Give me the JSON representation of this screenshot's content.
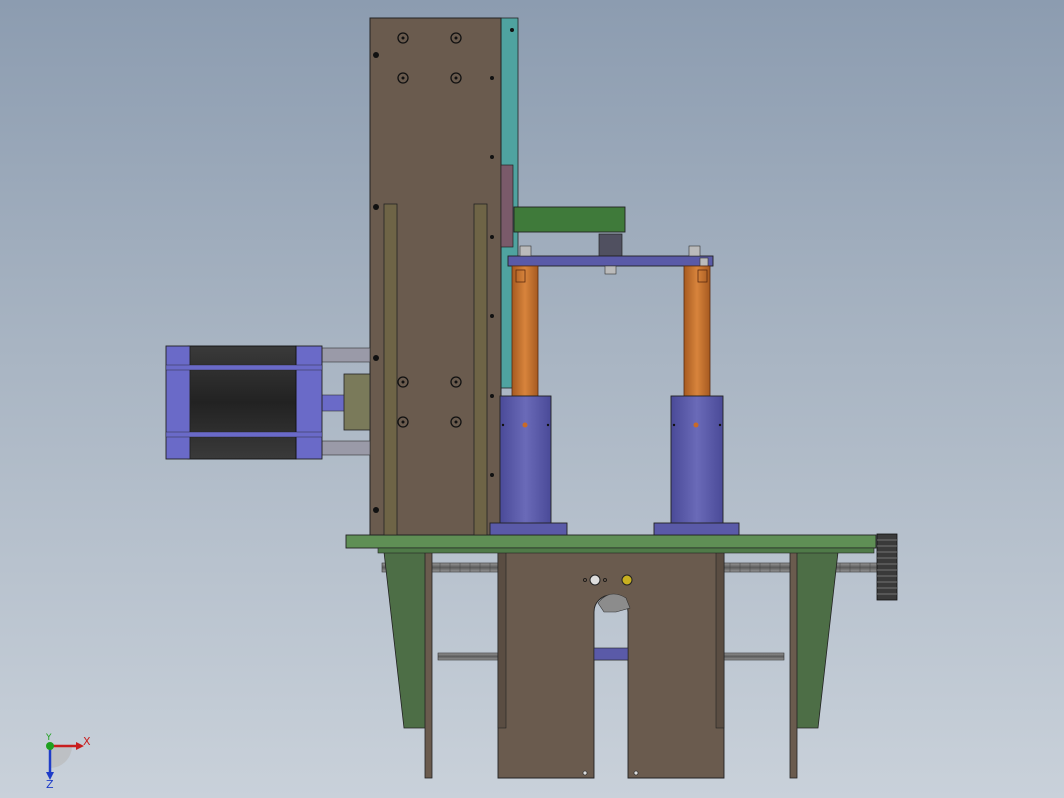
{
  "triad": {
    "x_label": "X",
    "y_label": "Y",
    "z_label": "Z",
    "x_color": "#c81e1e",
    "y_color": "#1ea01e",
    "z_color": "#1e3cc8"
  },
  "colors": {
    "background_top": "#8c9cb0",
    "background_bottom": "#c9d1da",
    "column_plate": "#6a5b4e",
    "frame_plate": "#6a5b4e",
    "guide_rail": "#6e6446",
    "side_rail": "#4fa3a0",
    "motor_body": "#2a2a2a",
    "motor_flange": "#6a6ac8",
    "green_arm": "#3f7a3a",
    "blue_parts": "#5a5aa8",
    "orange_rods": "#c86a28",
    "base_plate": "#5f8f55",
    "side_bracket": "#4d6e46",
    "lead_screw": "#808080",
    "knob": "#3a3a3a"
  }
}
